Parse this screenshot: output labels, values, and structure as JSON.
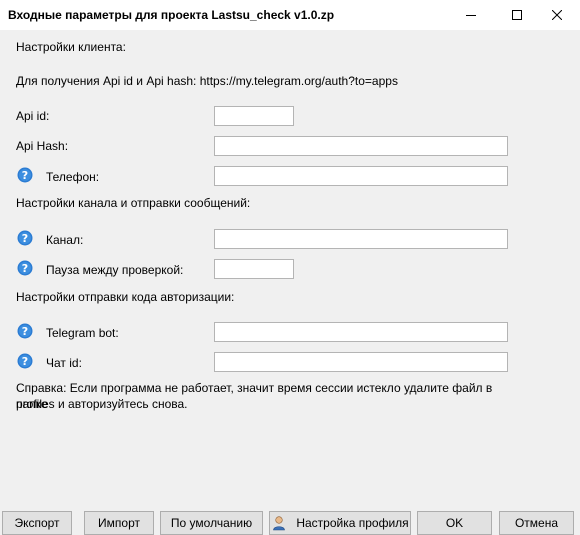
{
  "window": {
    "title": "Входные параметры для проекта Lastsu_check v1.0.zp",
    "minimize_icon": "minimize-icon",
    "maximize_icon": "maximize-icon",
    "close_icon": "close-icon"
  },
  "client_section": {
    "heading": "Настройки клиента:",
    "api_info": "Для получения Api id и Api hash: https://my.telegram.org/auth?to=apps",
    "api_id": {
      "label": "Api id:",
      "value": ""
    },
    "api_hash": {
      "label": "Api Hash:",
      "value": ""
    },
    "phone": {
      "label": "Телефон:",
      "value": "",
      "icon": "help-icon"
    }
  },
  "channel_section": {
    "heading": "Настройки канала и отправки сообщений:",
    "channel": {
      "label": "Канал:",
      "value": "",
      "icon": "help-icon"
    },
    "pause": {
      "label": "Пауза между проверкой:",
      "value": "",
      "icon": "help-icon"
    }
  },
  "auth_section": {
    "heading": "Настройки отправки кода авторизации:",
    "bot": {
      "label": "Telegram bot:",
      "value": "",
      "icon": "help-icon"
    },
    "chat_id": {
      "label": "Чат id:",
      "value": "",
      "icon": "help-icon"
    }
  },
  "note": {
    "line1": "Справка: Если программа не работает, значит время сессии истекло удалите файл в папке",
    "line2": "profiles и авторизуйтесь снова."
  },
  "buttons": {
    "export": "Экспорт",
    "import": "Импорт",
    "default": "По умолчанию",
    "profile": "Настройка профиля",
    "profile_icon": "user-avatar-icon",
    "ok": "OK",
    "cancel": "Отмена"
  },
  "colors": {
    "help_icon": "#2b7cd3",
    "background": "#f0f0f0",
    "button": "#e1e1e1"
  }
}
